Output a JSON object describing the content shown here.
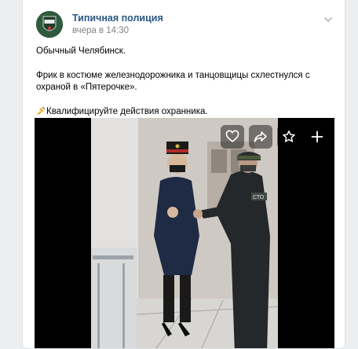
{
  "post": {
    "author": "Типичная полиция",
    "timestamp": "вчера в 14:30",
    "avatar_text": "ТИПИЧНАЯ\nПОЛИЦИЯ",
    "lines": [
      "Обычный Челябинск.",
      "Фрик в костюме железнодорожника и танцовщицы схлестнулся с охраной в «Пятерочке».",
      "Квалифицируйте действия охранника."
    ]
  },
  "video": {
    "actions": [
      "heart-icon",
      "share-icon",
      "star-icon",
      "plus-icon"
    ],
    "guard_patch": "СТО"
  },
  "colors": {
    "link": "#2a5885",
    "muted": "#828282",
    "page_bg": "#edeef0"
  }
}
